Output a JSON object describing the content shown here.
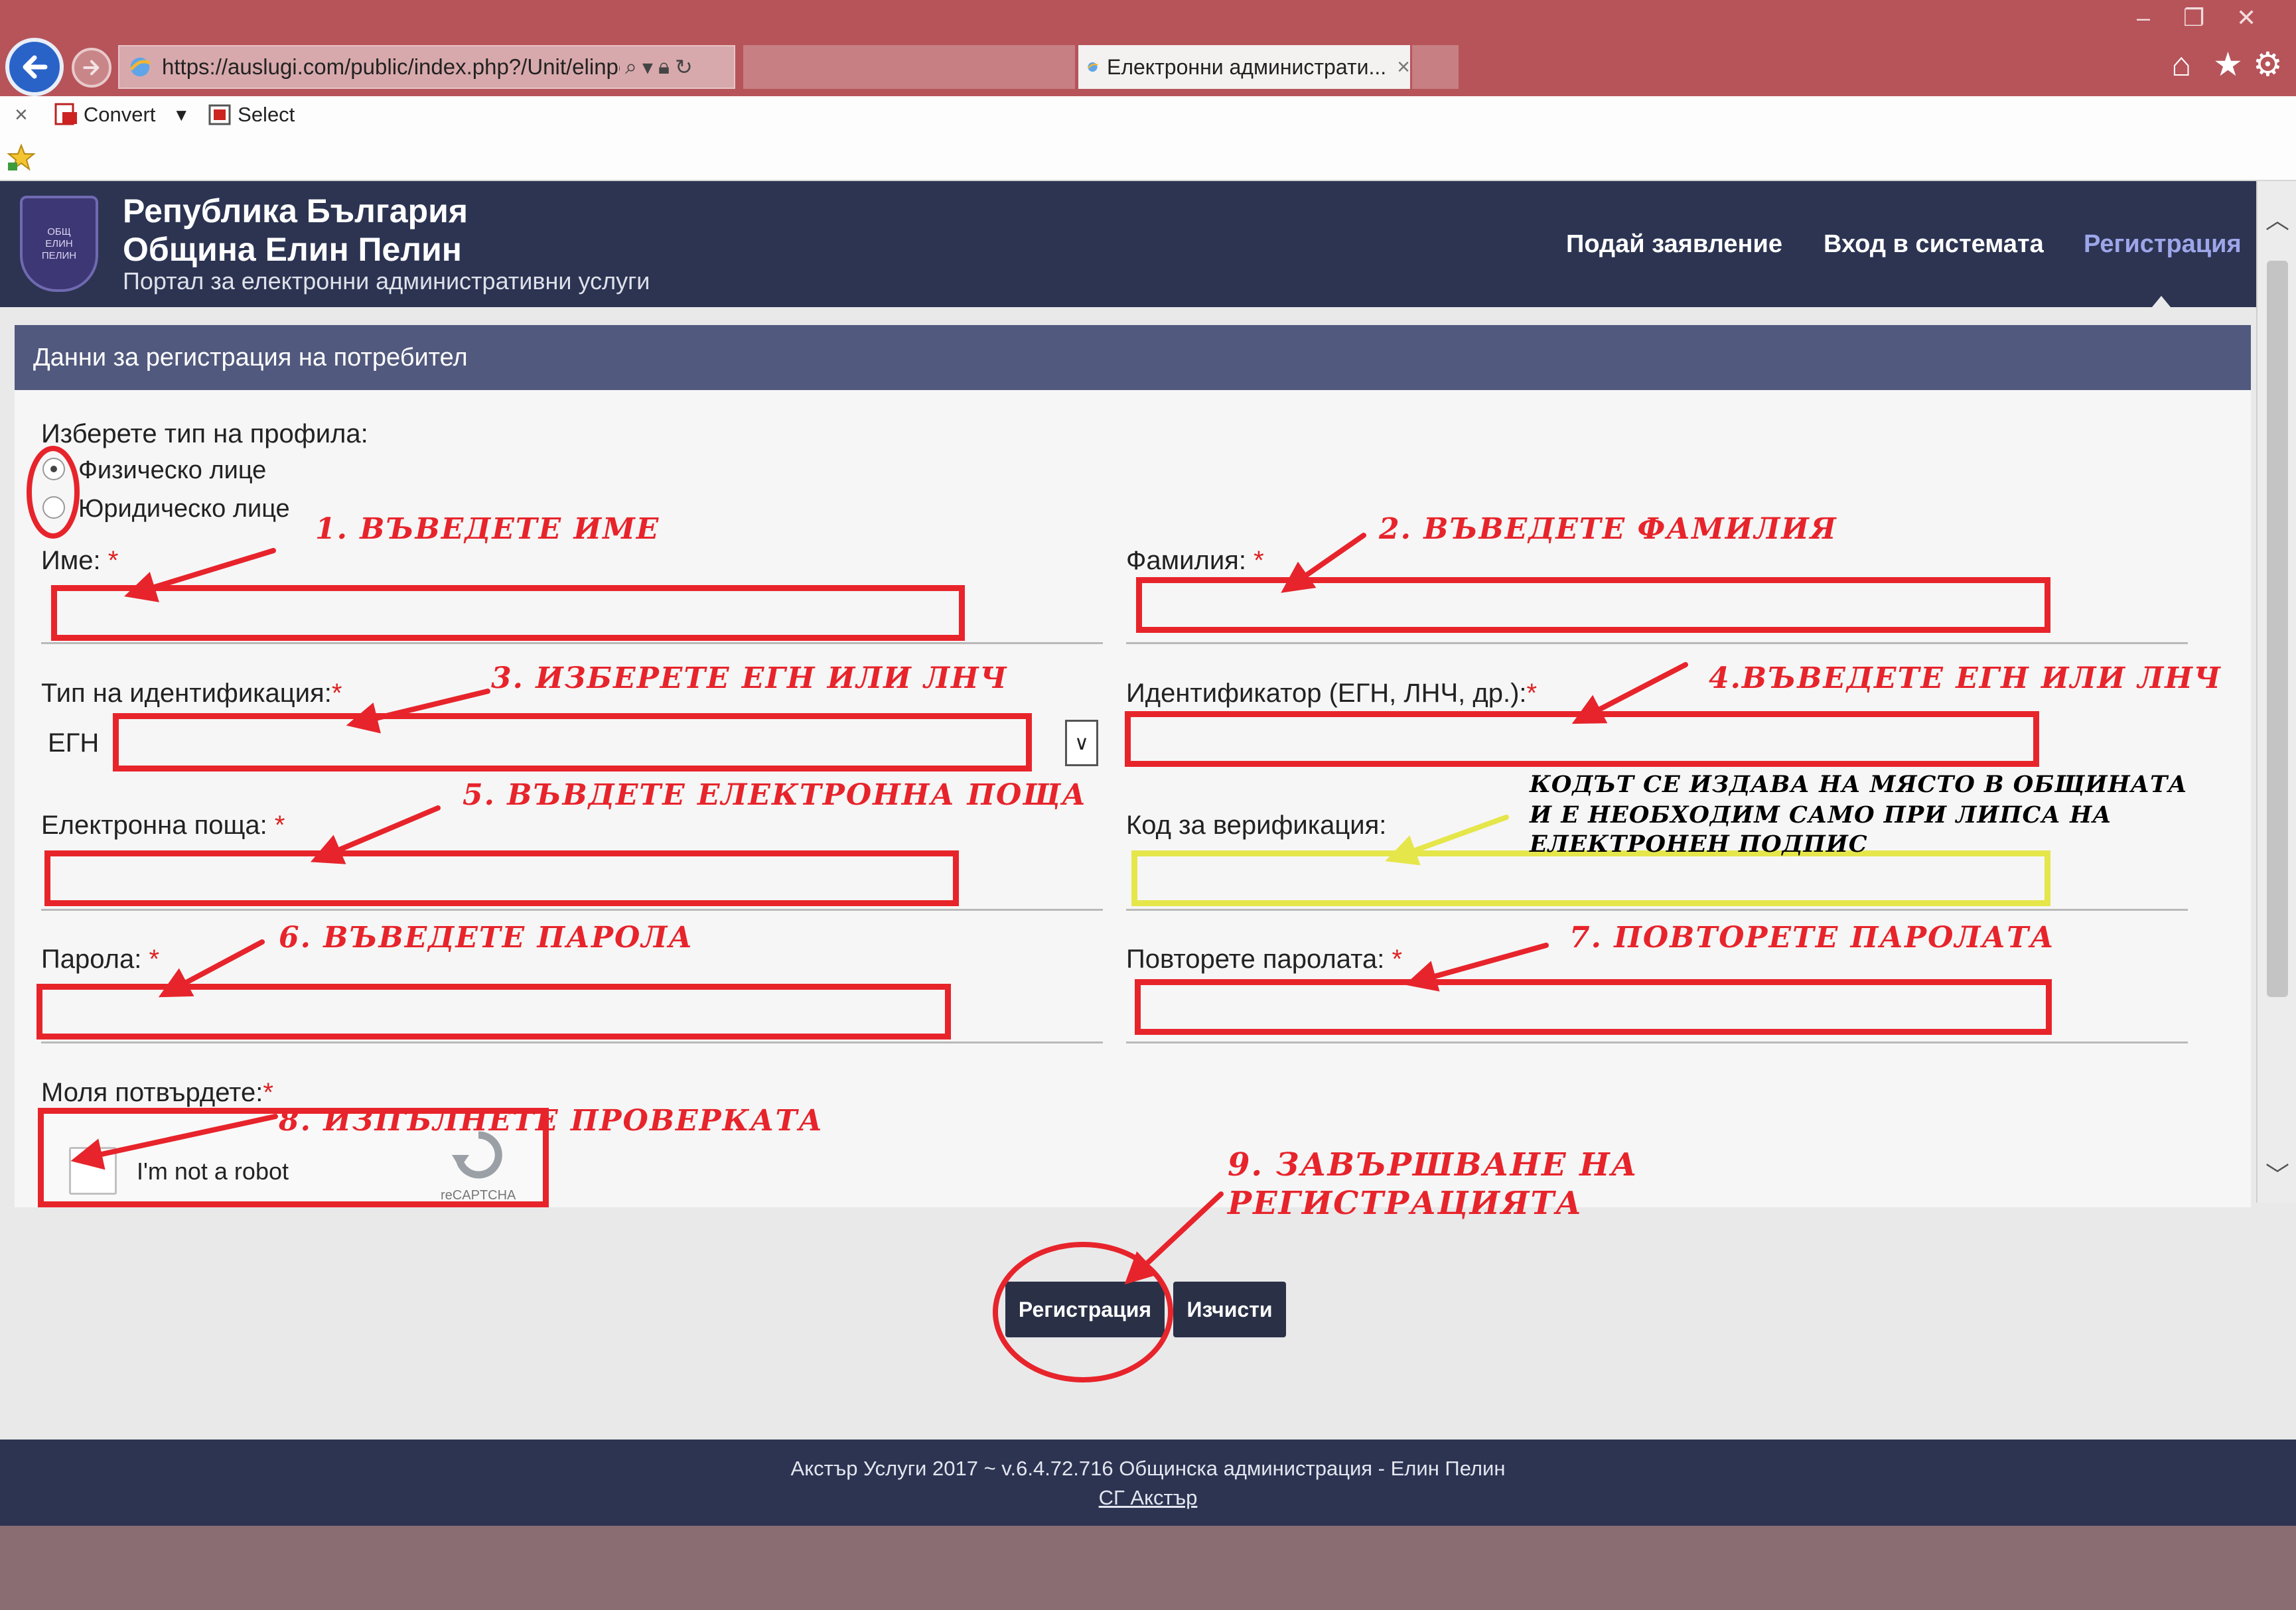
{
  "browser": {
    "url": "https://auslugi.com/public/index.php?/Unit/elinpe",
    "tab_title": "Електронни администрати...",
    "tab_close": "×",
    "toolbar_close": "×",
    "convert_label": "Convert",
    "select_label": "Select",
    "win_min": "‒",
    "win_max": "❐",
    "win_close": "✕"
  },
  "header": {
    "title_line1": "Република България",
    "title_line2": "Община Елин Пелин",
    "subtitle": "Портал за електронни административни услуги",
    "nav": [
      "Подай заявление",
      "Вход в системата",
      "Регистрация"
    ]
  },
  "form": {
    "panel_title": "Данни за регистрация на потребител",
    "profile_type_label": "Изберете тип на профила:",
    "profile_options": [
      "Физическо лице",
      "Юридическо лице"
    ],
    "first_name_label": "Име:",
    "last_name_label": "Фамилия:",
    "id_type_label": "Тип на идентификация:",
    "id_type_value": "ЕГН",
    "identifier_label": "Идентификатор (ЕГН, ЛНЧ, др.):",
    "email_label": "Електронна поща:",
    "verification_label": "Код за верификация:",
    "password_label": "Парола:",
    "repeat_password_label": "Повторете паролата:",
    "confirm_label": "Моля потвърдете:",
    "required_mark": "*",
    "captcha_text": "I'm not a robot",
    "captcha_brand": "reCAPTCHA",
    "register_button": "Регистрация",
    "clear_button": "Изчисти"
  },
  "annotations": {
    "a1": "1. ВЪВЕДЕТЕ  ИМЕ",
    "a2": "2. ВЪВЕДЕТЕ ФАМИЛИЯ",
    "a3": "3. ИЗБЕРЕТЕ ЕГН ИЛИ ЛНЧ",
    "a4": "4.ВЪВЕДЕТЕ ЕГН ИЛИ ЛНЧ",
    "a5": "5. ВЪВДЕТЕ ЕЛЕКТРОННА ПОЩА",
    "a6": "6. ВЪВЕДЕТЕ ПАРОЛА",
    "a7": "7. ПОВТОРЕТЕ ПАРОЛАТА",
    "a8": "8. ИЗПЪЛНЕТЕ ПРОВЕРКАТА",
    "a9_line1": "9. ЗАВЪРШВАНЕ НА",
    "a9_line2": "РЕГИСТРАЦИЯТА",
    "note_line1": "КОДЪТ СЕ ИЗДАВА НА МЯСТО В ОБЩИНАТА",
    "note_line2": "И Е НЕОБХОДИМ САМО ПРИ ЛИПСА НА",
    "note_line3": "ЕЛЕКТРОНЕН ПОДПИС"
  },
  "footer": {
    "text": "Акстър Услуги 2017 ~ v.6.4.72.716 Общинска администрация - Елин Пелин",
    "link": "СГ Акстър"
  },
  "colors": {
    "annotation_red": "#e7242b",
    "annotation_yellow": "#e5e64a",
    "header_navy": "#2c3452",
    "panel_header": "#52597e"
  }
}
